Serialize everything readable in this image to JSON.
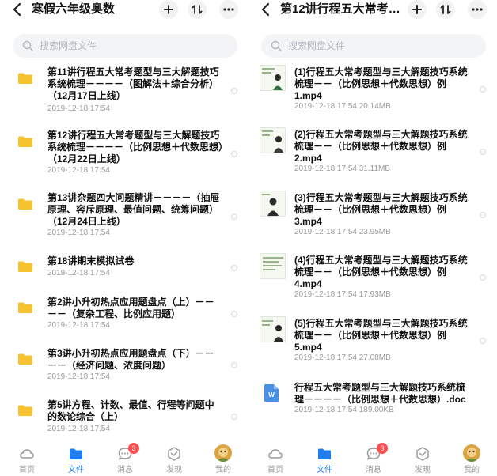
{
  "left": {
    "title": "寒假六年级奥数",
    "search_placeholder": "搜索网盘文件",
    "items": [
      {
        "name": "第11讲行程五大常考题型与三大解题技巧系统梳理－－－－（图解法＋综合分析）（12月17日上线）",
        "meta": "2019-12-18  17:54"
      },
      {
        "name": "第12讲行程五大常考题型与三大解题技巧系统梳理－－－－（比例思想＋代数思想）（12月22日上线）",
        "meta": "2019-12-18  17:54"
      },
      {
        "name": "第13讲杂题四大问题精讲－－－－（抽屉原理、容斥原理、最值问题、统筹问题）（12月24日上线）",
        "meta": "2019-12-18  17:54"
      },
      {
        "name": "第18讲期末模拟试卷",
        "meta": "2019-12-18  17:54"
      },
      {
        "name": "第2讲小升初热点应用题盘点（上）－－－－（复杂工程、比例应用题）",
        "meta": "2019-12-18  17:54"
      },
      {
        "name": "第3讲小升初热点应用题盘点（下）－－－－（经济问题、浓度问题）",
        "meta": "2019-12-18  17:54"
      },
      {
        "name": "第5讲方程、计数、最值、行程等问题中的数论综合（上）",
        "meta": "2019-12-18  17:54"
      }
    ]
  },
  "right": {
    "title": "第12讲行程五大常考题...",
    "search_placeholder": "搜索网盘文件",
    "items": [
      {
        "name": "(1)行程五大常考题型与三大解题技巧系统梳理－－（比例思想＋代数思想）例1.mp4",
        "meta": "2019-12-18  17:54  20.14MB"
      },
      {
        "name": "(2)行程五大常考题型与三大解题技巧系统梳理－－（比例思想＋代数思想）例2.mp4",
        "meta": "2019-12-18  17:54  31.11MB"
      },
      {
        "name": "(3)行程五大常考题型与三大解题技巧系统梳理－－（比例思想＋代数思想）例3.mp4",
        "meta": "2019-12-18  17:54  23.95MB"
      },
      {
        "name": "(4)行程五大常考题型与三大解题技巧系统梳理－－（比例思想＋代数思想）例4.mp4",
        "meta": "2019-12-18  17:54  17.93MB"
      },
      {
        "name": "(5)行程五大常考题型与三大解题技巧系统梳理－－（比例思想＋代数思想）例5.mp4",
        "meta": "2019-12-18  17:54  27.08MB"
      },
      {
        "name": "行程五大常考题型与三大解题技巧系统梳理－－－－（比例思想＋代数思想）.doc",
        "meta": "2019-12-18  17:54  189.00KB"
      }
    ]
  },
  "tabs": [
    {
      "label": "首页",
      "icon": "cloud-icon"
    },
    {
      "label": "文件",
      "icon": "folder-icon",
      "active": true
    },
    {
      "label": "消息",
      "icon": "chat-icon",
      "badge": "3"
    },
    {
      "label": "发现",
      "icon": "discover-icon"
    },
    {
      "label": "我的",
      "icon": "avatar"
    }
  ],
  "colors": {
    "accent": "#1f7ef2",
    "folder": "#f7c22f",
    "badge": "#ff4d4f",
    "doc": "#4a90e2"
  }
}
